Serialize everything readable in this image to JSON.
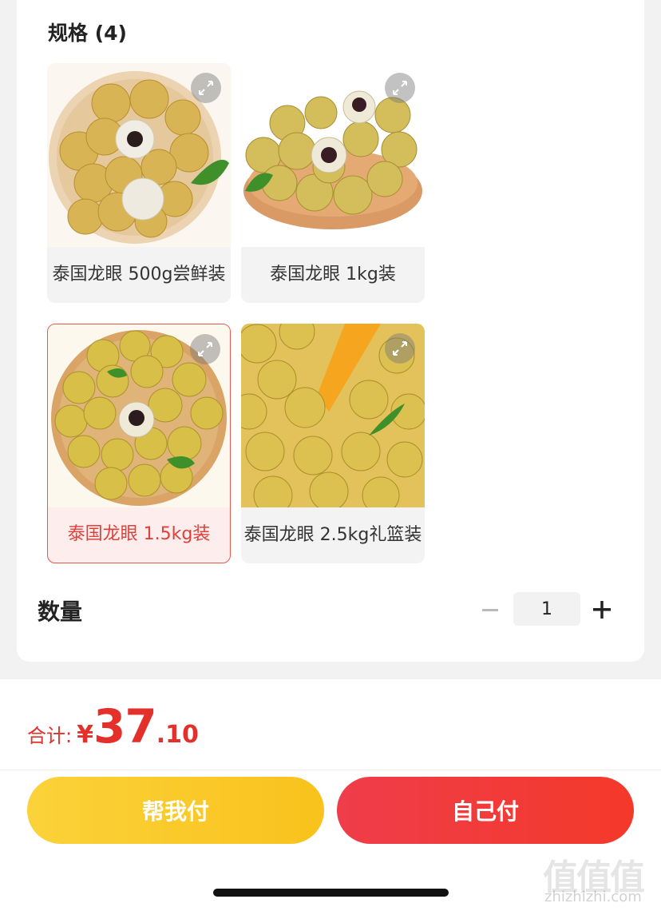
{
  "spec": {
    "title": "规格 (4)",
    "options": [
      {
        "label": "泰国龙眼 500g尝鲜装",
        "selected": false
      },
      {
        "label": "泰国龙眼 1kg装",
        "selected": false
      },
      {
        "label": "泰国龙眼 1.5kg装",
        "selected": true
      },
      {
        "label": "泰国龙眼 2.5kg礼篮装",
        "selected": false
      }
    ]
  },
  "quantity": {
    "label": "数量",
    "value": "1"
  },
  "total": {
    "label": "合计:",
    "currency": "¥",
    "integer": "37",
    "decimal": ".10"
  },
  "buttons": {
    "help_pay": "帮我付",
    "self_pay": "自己付"
  },
  "watermark": {
    "site": "zhizhizhi.com",
    "glyphs": "值值值"
  },
  "colors": {
    "accent": "#e3302b",
    "help_button": "#f9c21c",
    "self_button": "#f23a3a"
  }
}
